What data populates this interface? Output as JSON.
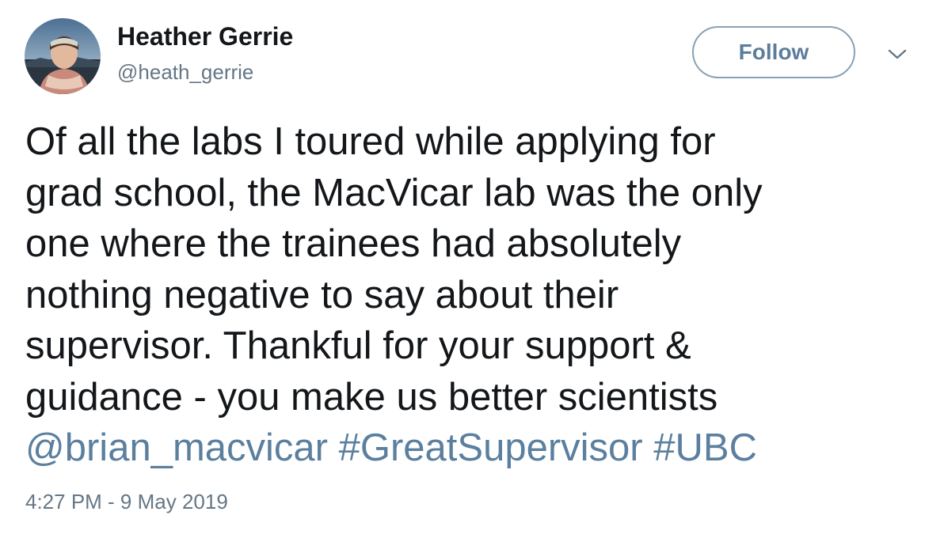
{
  "author": {
    "name": "Heather Gerrie",
    "handle": "@heath_gerrie",
    "avatar_icon": "profile-photo"
  },
  "actions": {
    "follow_label": "Follow",
    "menu_icon": "chevron-down-icon"
  },
  "tweet": {
    "lines": [
      "Of all the labs I toured while applying for",
      "grad school, the MacVicar lab was the only",
      "one where the trainees had absolutely",
      "nothing negative to say about their",
      "supervisor. Thankful for your support &",
      "guidance - you make us better scientists"
    ],
    "mention": "@brian_macvicar",
    "hashtags": [
      "#GreatSupervisor",
      "#UBC"
    ],
    "timestamp": "4:27 PM - 9 May 2019"
  },
  "colors": {
    "text": "#14171a",
    "secondary": "#657786",
    "link": "#5b7f9e",
    "follow_border": "#8aa1b3"
  }
}
